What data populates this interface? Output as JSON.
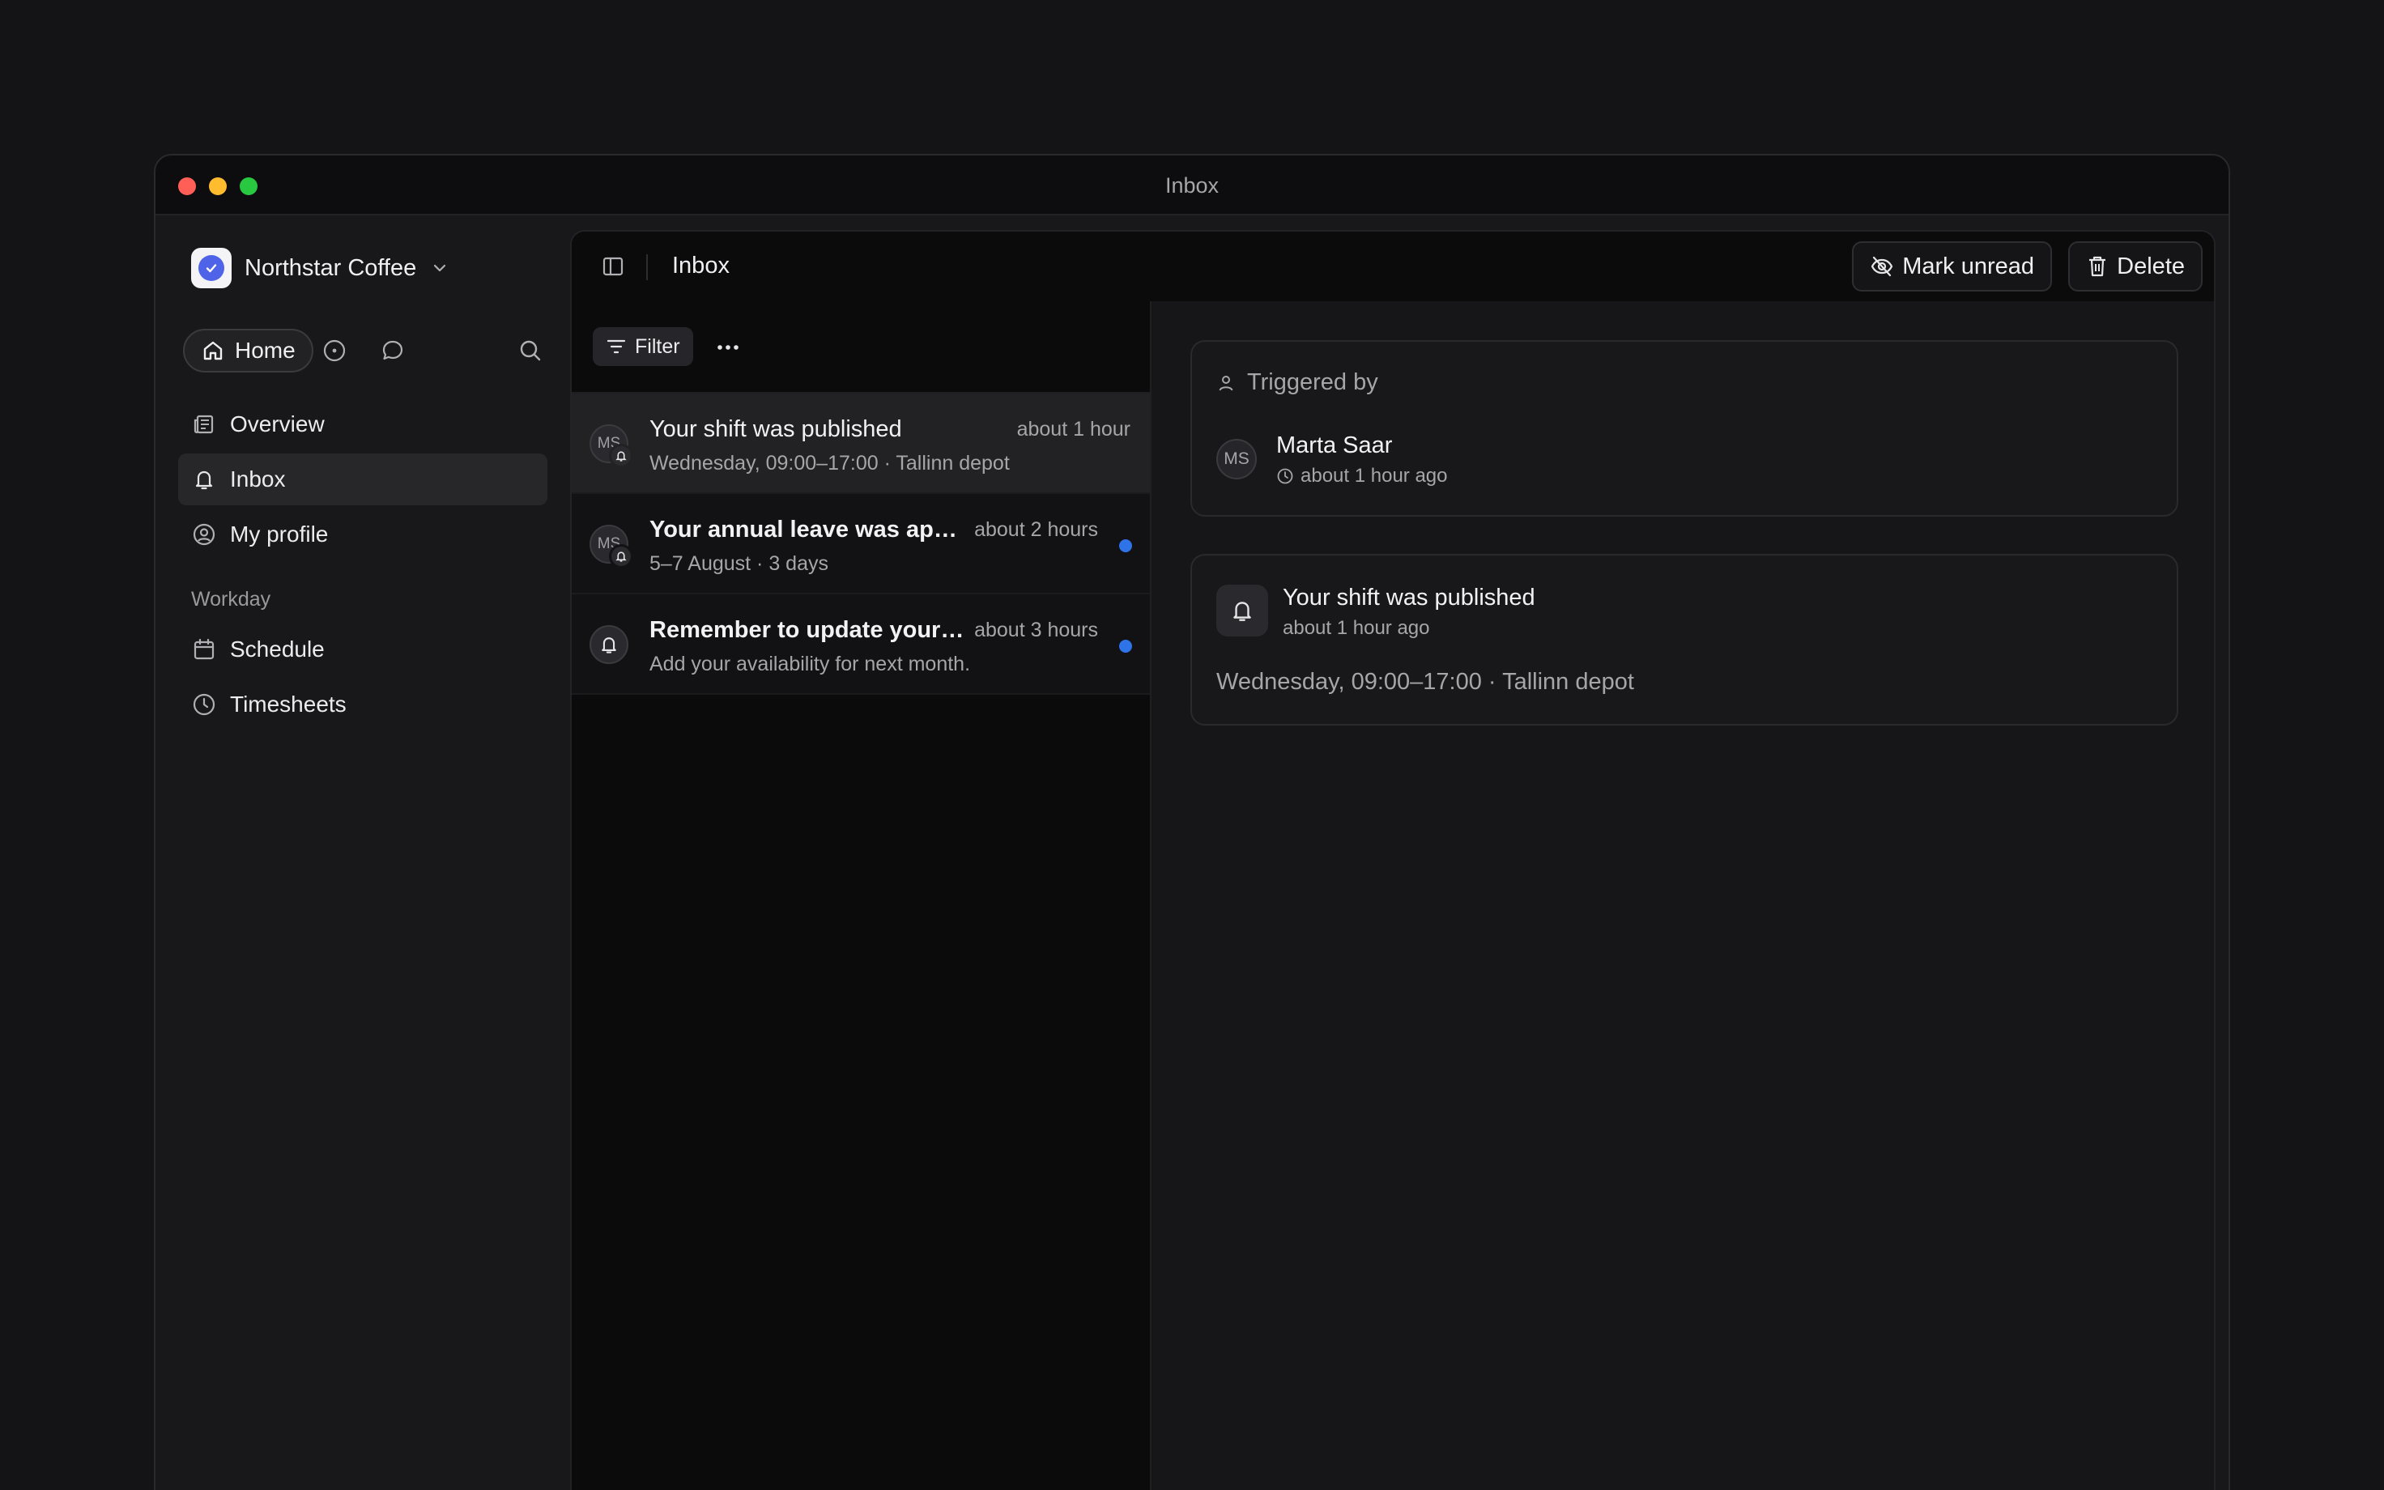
{
  "window": {
    "title": "Inbox"
  },
  "sidebar": {
    "org_name": "Northstar Coffee",
    "home_label": "Home",
    "items": [
      {
        "label": "Overview",
        "icon": "newspaper-icon"
      },
      {
        "label": "Inbox",
        "icon": "bell-icon",
        "active": true
      },
      {
        "label": "My profile",
        "icon": "user-circle-icon"
      }
    ],
    "section_label": "Workday",
    "section_items": [
      {
        "label": "Schedule",
        "icon": "calendar-icon"
      },
      {
        "label": "Timesheets",
        "icon": "clock-icon"
      }
    ]
  },
  "header": {
    "title": "Inbox",
    "mark_unread_label": "Mark unread",
    "delete_label": "Delete"
  },
  "list": {
    "filter_label": "Filter",
    "rows": [
      {
        "avatar": "MS",
        "title": "Your shift was published",
        "subtitle": "Wednesday, 09:00–17:00 · Tallinn depot",
        "time": "about 1 hour",
        "unread": false,
        "selected": true
      },
      {
        "avatar": "MS",
        "title": "Your annual leave was app...",
        "subtitle": "5–7 August · 3 days",
        "time": "about 2 hours",
        "unread": true,
        "selected": false
      },
      {
        "avatar": "",
        "title": "Remember to update your ...",
        "subtitle": "Add your availability for next month.",
        "time": "about 3 hours",
        "unread": true,
        "selected": false
      }
    ]
  },
  "detail": {
    "triggered_by_label": "Triggered by",
    "user_initials": "MS",
    "user_name": "Marta Saar",
    "user_time": "about 1 hour ago",
    "note_title": "Your shift was published",
    "note_time": "about 1 hour ago",
    "note_body": "Wednesday, 09:00–17:00 · Tallinn depot"
  },
  "colors": {
    "accent": "#4f63e8",
    "unread_dot": "#2f73e8"
  }
}
